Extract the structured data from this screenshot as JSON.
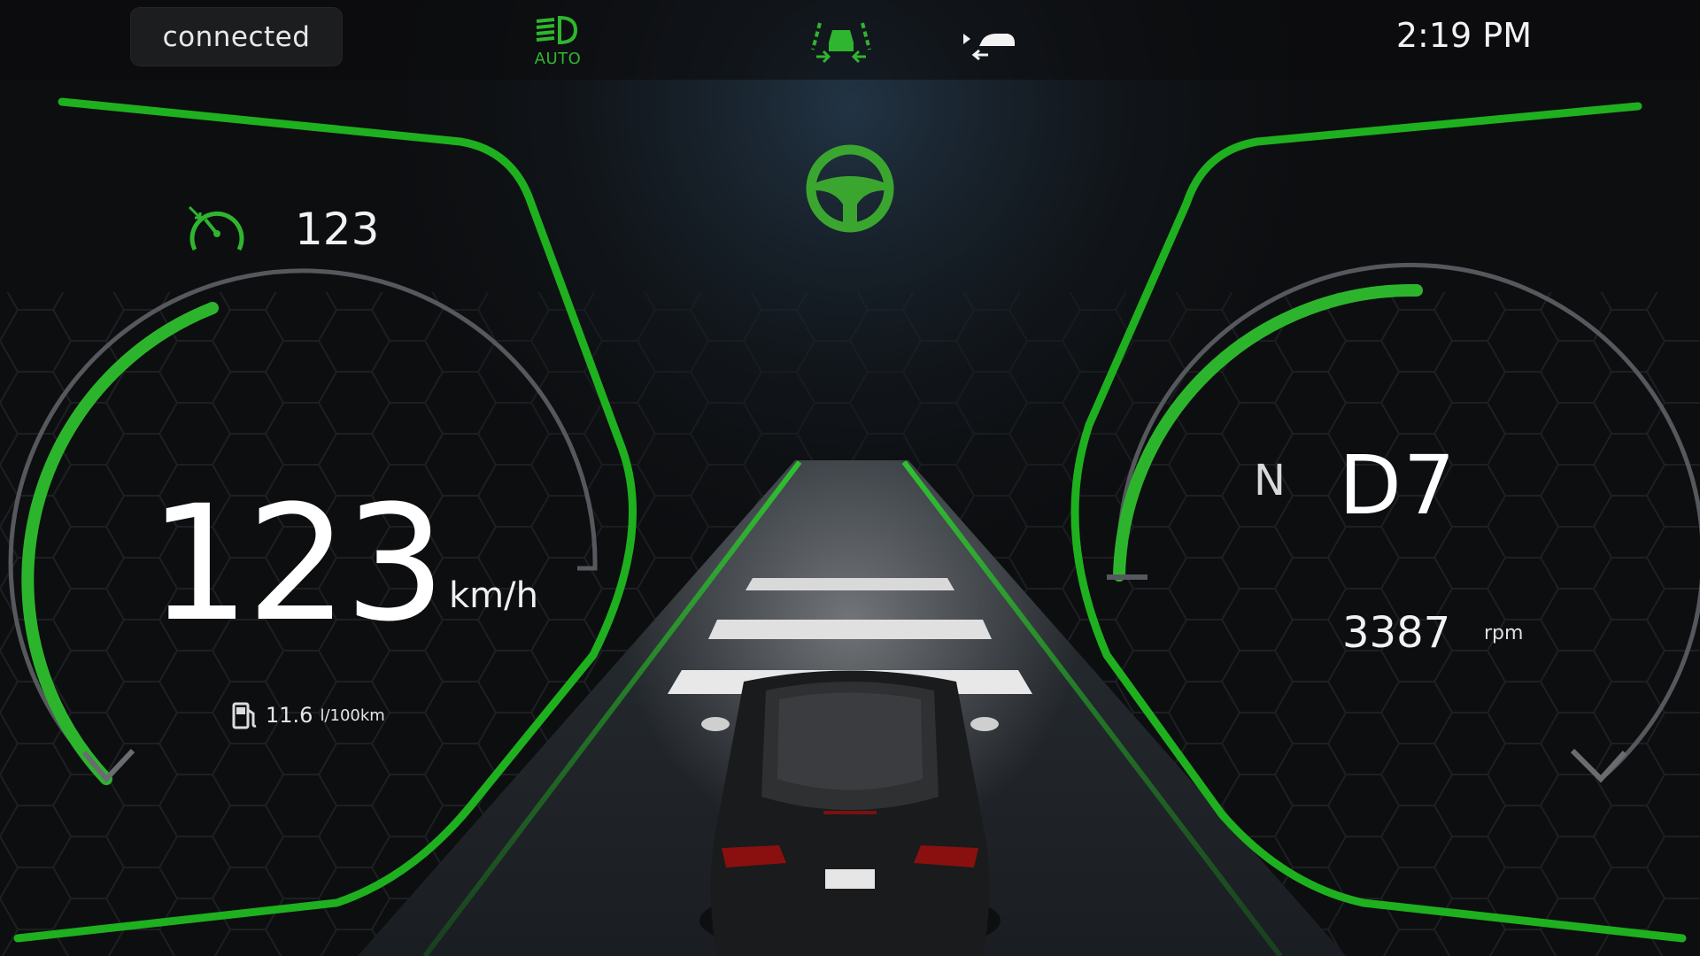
{
  "status": {
    "connection": "connected"
  },
  "clock": {
    "time": "2:19 PM"
  },
  "indicators": {
    "headlights": {
      "icon": "auto-headlight-icon",
      "label": "AUTO",
      "color": "#2fb52f"
    },
    "lane_assist": {
      "icon": "lane-assist-icon",
      "color": "#2fb52f"
    },
    "follow_distance": {
      "icon": "follow-distance-icon",
      "color": "#f2f2f2"
    },
    "steering_assist": {
      "icon": "steering-wheel-icon",
      "color": "#3aa62f"
    }
  },
  "speedometer": {
    "cruise_icon": "cruise-control-icon",
    "cruise_speed": "123",
    "speed": "123",
    "unit": "km/h",
    "fuel_icon": "fuel-pump-icon",
    "fuel_value": "11.6",
    "fuel_unit": "l/100km"
  },
  "transmission": {
    "mode": "N",
    "gear": "D7",
    "rpm": "3387",
    "rpm_unit": "rpm"
  },
  "colors": {
    "accent": "#22b522",
    "background": "#0b0c0e"
  }
}
